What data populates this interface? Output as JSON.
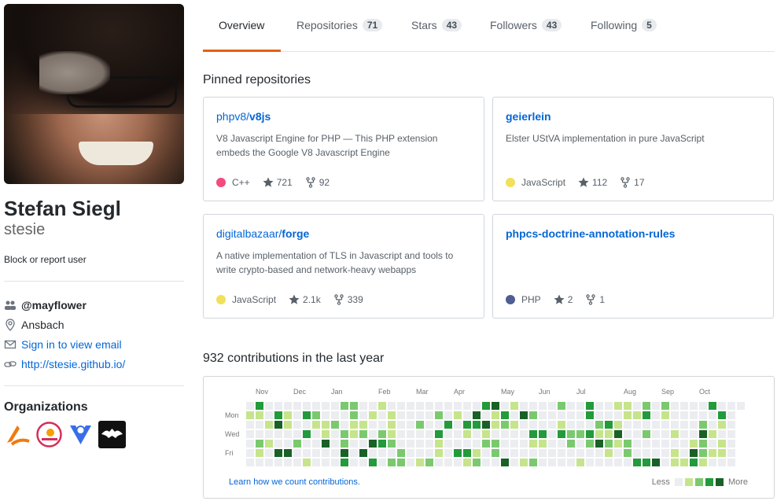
{
  "profile": {
    "name": "Stefan Siegl",
    "login": "stesie",
    "block_text": "Block or report user",
    "org_handle": "@mayflower",
    "location": "Ansbach",
    "email_text": "Sign in to view email",
    "website": "http://stesie.github.io/",
    "organizations_title": "Organizations"
  },
  "tabs": [
    {
      "label": "Overview",
      "count": ""
    },
    {
      "label": "Repositories",
      "count": "71"
    },
    {
      "label": "Stars",
      "count": "43"
    },
    {
      "label": "Followers",
      "count": "43"
    },
    {
      "label": "Following",
      "count": "5"
    }
  ],
  "pinned": {
    "title": "Pinned repositories",
    "repos": [
      {
        "owner": "phpv8/",
        "name": "v8js",
        "desc": "V8 Javascript Engine for PHP — This PHP extension embeds the Google V8 Javascript Engine",
        "lang": "C++",
        "lang_color": "#f34b7d",
        "stars": "721",
        "forks": "92"
      },
      {
        "owner": "",
        "name": "geierlein",
        "desc": "Elster UStVA implementation in pure JavaScript",
        "lang": "JavaScript",
        "lang_color": "#f1e05a",
        "stars": "112",
        "forks": "17"
      },
      {
        "owner": "digitalbazaar/",
        "name": "forge",
        "desc": "A native implementation of TLS in Javascript and tools to write crypto-based and network-heavy webapps",
        "lang": "JavaScript",
        "lang_color": "#f1e05a",
        "stars": "2.1k",
        "forks": "339"
      },
      {
        "owner": "",
        "name": "phpcs-doctrine-annotation-rules",
        "desc": "",
        "lang": "PHP",
        "lang_color": "#4F5D95",
        "stars": "2",
        "forks": "1"
      }
    ]
  },
  "contributions": {
    "title": "932 contributions in the last year",
    "months": [
      "Nov",
      "Dec",
      "Jan",
      "Feb",
      "Mar",
      "Apr",
      "May",
      "Jun",
      "Jul",
      "Aug",
      "Sep",
      "Oct"
    ],
    "days": [
      "Mon",
      "Wed",
      "Fri"
    ],
    "learn_link": "Learn how we count contributions.",
    "legend_less": "Less",
    "legend_more": "More",
    "levels": [
      "#ebedf0",
      "#c6e48b",
      "#7bc96f",
      "#239a3b",
      "#196127"
    ]
  }
}
